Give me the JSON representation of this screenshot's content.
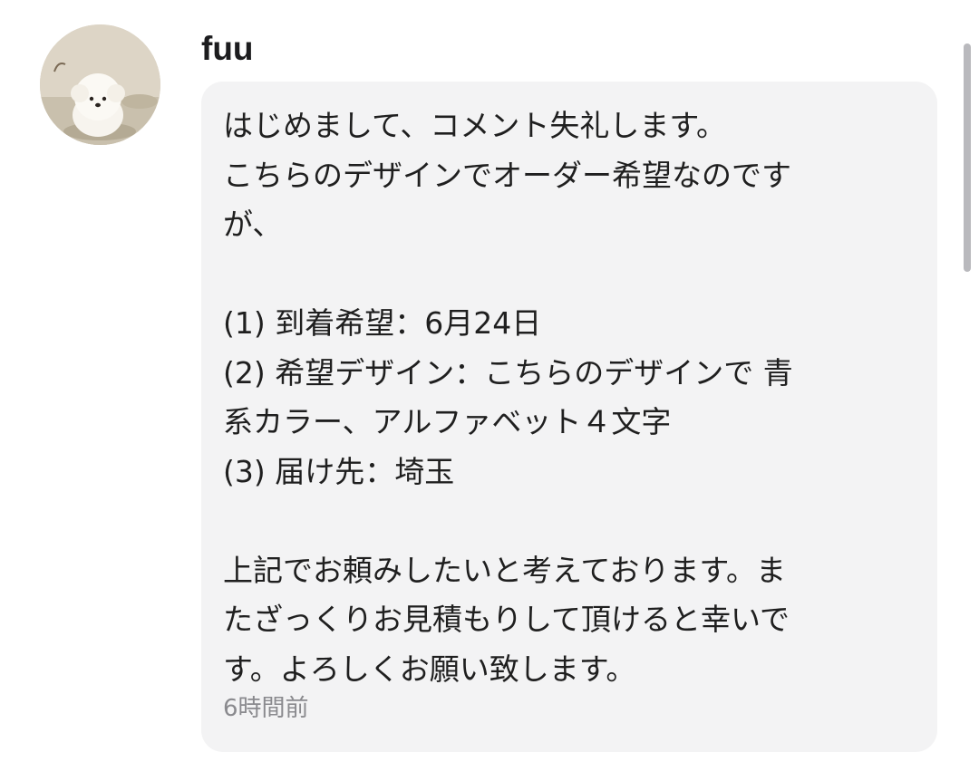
{
  "comment": {
    "username": "fuu",
    "avatar": "avatar-dog-photo",
    "text": "はじめまして、コメント失礼します。\nこちらのデザインでオーダー希望なのです\nが、\n\n(1) 到着希望：6月24日\n(2) 希望デザイン：こちらのデザインで 青\n系カラー、アルファベット４文字\n(3) 届け先：埼玉\n\n上記でお頼みしたいと考えております。ま\nたざっくりお見積もりして頂けると幸いで\nす。よろしくお願い致します。",
    "timestamp": "6時間前"
  },
  "colors": {
    "bubble_background": "#f3f3f4",
    "text": "#1f1f1f",
    "timestamp": "#8a8a8e",
    "scrollbar": "#b9b9bd"
  }
}
